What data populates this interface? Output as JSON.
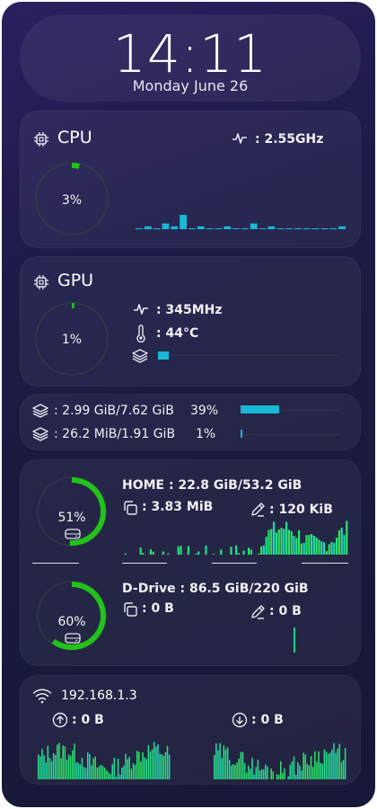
{
  "clock": {
    "time": "14:11",
    "date": "Monday June 26"
  },
  "cpu": {
    "title": "CPU",
    "usage": "3%",
    "usage_fraction": 0.03,
    "freq": ": 2.55GHz",
    "history": [
      0,
      1,
      0,
      2,
      1,
      5,
      0,
      1,
      0,
      0,
      1,
      0,
      0,
      2,
      0,
      1,
      0,
      0,
      0,
      0,
      0,
      0,
      0,
      1
    ]
  },
  "gpu": {
    "title": "GPU",
    "usage": "1%",
    "usage_fraction": 0.01,
    "freq": ": 345MHz",
    "temp": ": 44°C",
    "mem_fraction": 0.06
  },
  "memory": {
    "ram_text": ": 2.99 GiB/7.62 GiB",
    "ram_pct": "39%",
    "ram_fraction": 0.39,
    "swap_text": ": 26.2 MiB/1.91 GiB",
    "swap_pct": "1%",
    "swap_fraction": 0.01
  },
  "disks": [
    {
      "name": "HOME : 22.8 GiB/53.2 GiB",
      "usage": "51%",
      "usage_fraction": 0.51,
      "read": ": 3.83 MiB",
      "write": ": 120 KiB"
    },
    {
      "name": "D-Drive : 86.5 GiB/220 GiB",
      "usage": "60%",
      "usage_fraction": 0.6,
      "read": ": 0 B",
      "write": ": 0 B"
    }
  ],
  "network": {
    "ip": "192.168.1.3",
    "upload": ": 0 B",
    "download": ": 0 B"
  },
  "colors": {
    "accent_green": "#22c21a",
    "accent_cyan": "#19b8d4",
    "track": "#2c3a4a"
  }
}
